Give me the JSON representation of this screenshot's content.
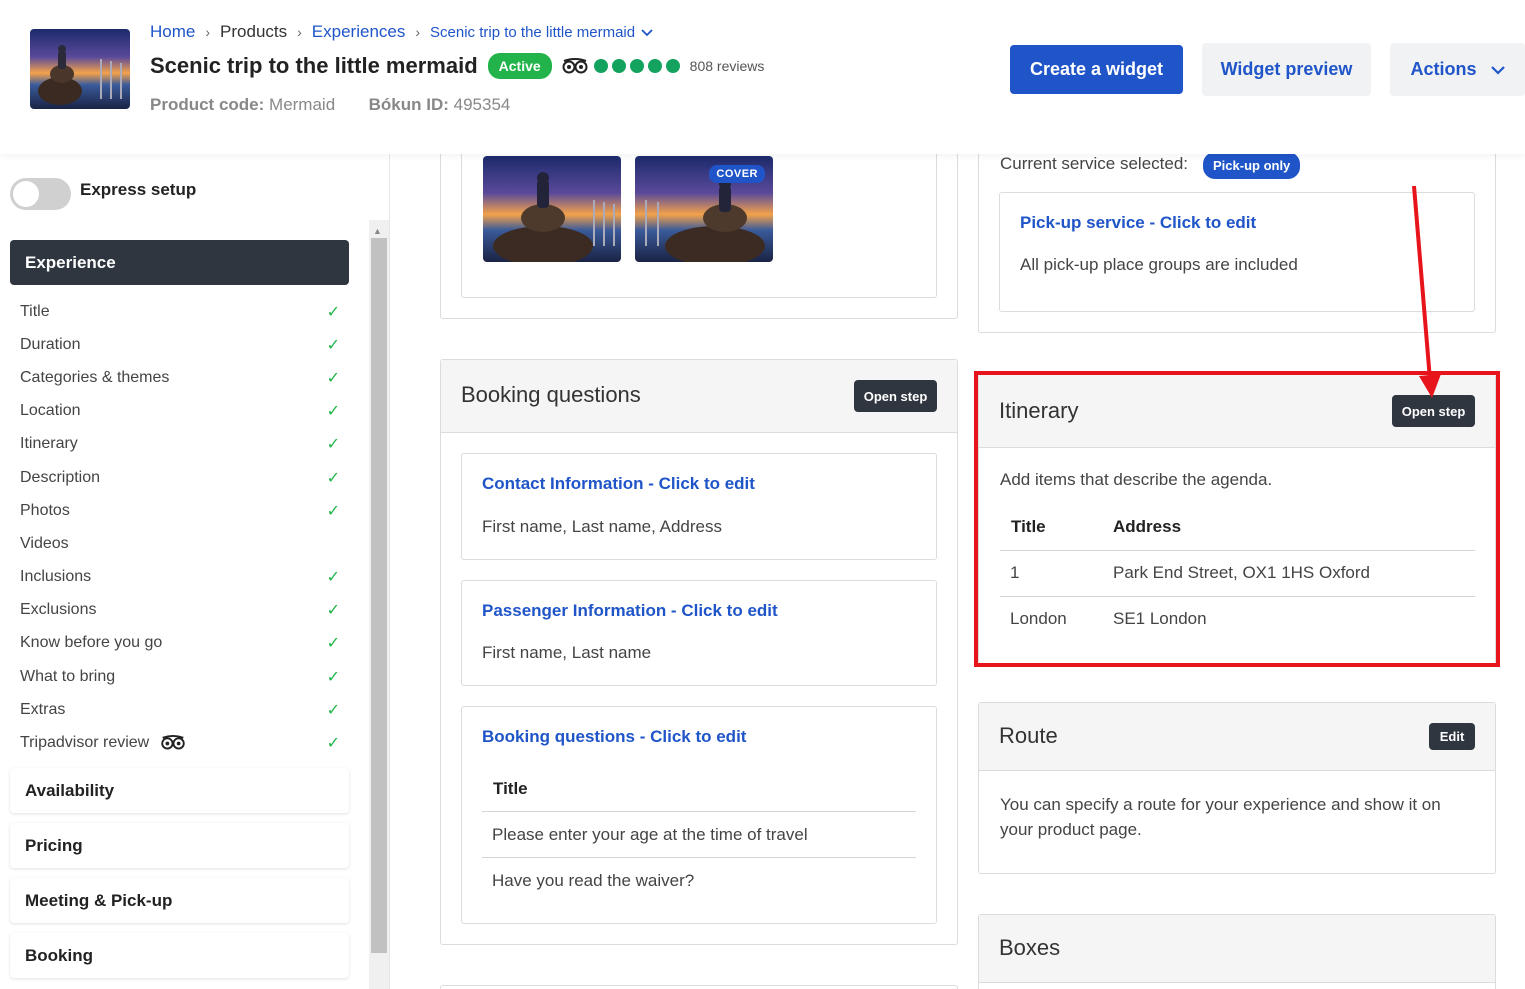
{
  "header": {
    "breadcrumb": {
      "home": "Home",
      "products": "Products",
      "experiences": "Experiences",
      "current": "Scenic trip to the little mermaid",
      "separator": "›"
    },
    "title": "Scenic trip to the little mermaid",
    "status": "Active",
    "reviews": "808 reviews",
    "rating_bubbles": 5,
    "product_code_label": "Product code:",
    "product_code": "Mermaid",
    "bokun_id_label": "Bókun ID:",
    "bokun_id": "495354",
    "buttons": {
      "create_widget": "Create a widget",
      "widget_preview": "Widget preview",
      "actions": "Actions"
    }
  },
  "sidebar": {
    "express_setup": "Express setup",
    "express_setup_on": false,
    "active_section": "Experience",
    "items": [
      {
        "label": "Title",
        "done": true
      },
      {
        "label": "Duration",
        "done": true
      },
      {
        "label": "Categories & themes",
        "done": true
      },
      {
        "label": "Location",
        "done": true
      },
      {
        "label": "Itinerary",
        "done": true
      },
      {
        "label": "Description",
        "done": true
      },
      {
        "label": "Photos",
        "done": true
      },
      {
        "label": "Videos",
        "done": false
      },
      {
        "label": "Inclusions",
        "done": true
      },
      {
        "label": "Exclusions",
        "done": true
      },
      {
        "label": "Know before you go",
        "done": true
      },
      {
        "label": "What to bring",
        "done": true
      },
      {
        "label": "Extras",
        "done": true
      },
      {
        "label": "Tripadvisor review",
        "done": true
      }
    ],
    "sections": [
      "Availability",
      "Pricing",
      "Meeting & Pick-up",
      "Booking"
    ]
  },
  "photos": {
    "cover_label": "COVER"
  },
  "pickup": {
    "current_label": "Current service selected:",
    "current_value": "Pick-up only",
    "link": "Pick-up service - Click to edit",
    "desc": "All pick-up place groups are included"
  },
  "booking_questions": {
    "title": "Booking questions",
    "open_step": "Open step",
    "contact": {
      "link": "Contact Information - Click to edit",
      "desc": "First name, Last name, Address"
    },
    "passenger": {
      "link": "Passenger Information - Click to edit",
      "desc": "First name, Last name"
    },
    "questions": {
      "link": "Booking questions - Click to edit",
      "column": "Title",
      "rows": [
        "Please enter your age at the time of travel",
        "Have you read the waiver?"
      ]
    }
  },
  "itinerary": {
    "title": "Itinerary",
    "open_step": "Open step",
    "desc": "Add items that describe the agenda.",
    "columns": [
      "Title",
      "Address"
    ],
    "rows": [
      {
        "title": "1",
        "address": "Park End Street, OX1 1HS Oxford"
      },
      {
        "title": "London",
        "address": "SE1 London"
      }
    ]
  },
  "route": {
    "title": "Route",
    "edit": "Edit",
    "desc": "You can specify a route for your experience and show it on your product page."
  },
  "boxes": {
    "title": "Boxes"
  },
  "colors": {
    "primary_blue": "#1f55c8",
    "active_green": "#22b44a",
    "dark_button": "#2f3640",
    "highlight_red": "#e8141b"
  }
}
